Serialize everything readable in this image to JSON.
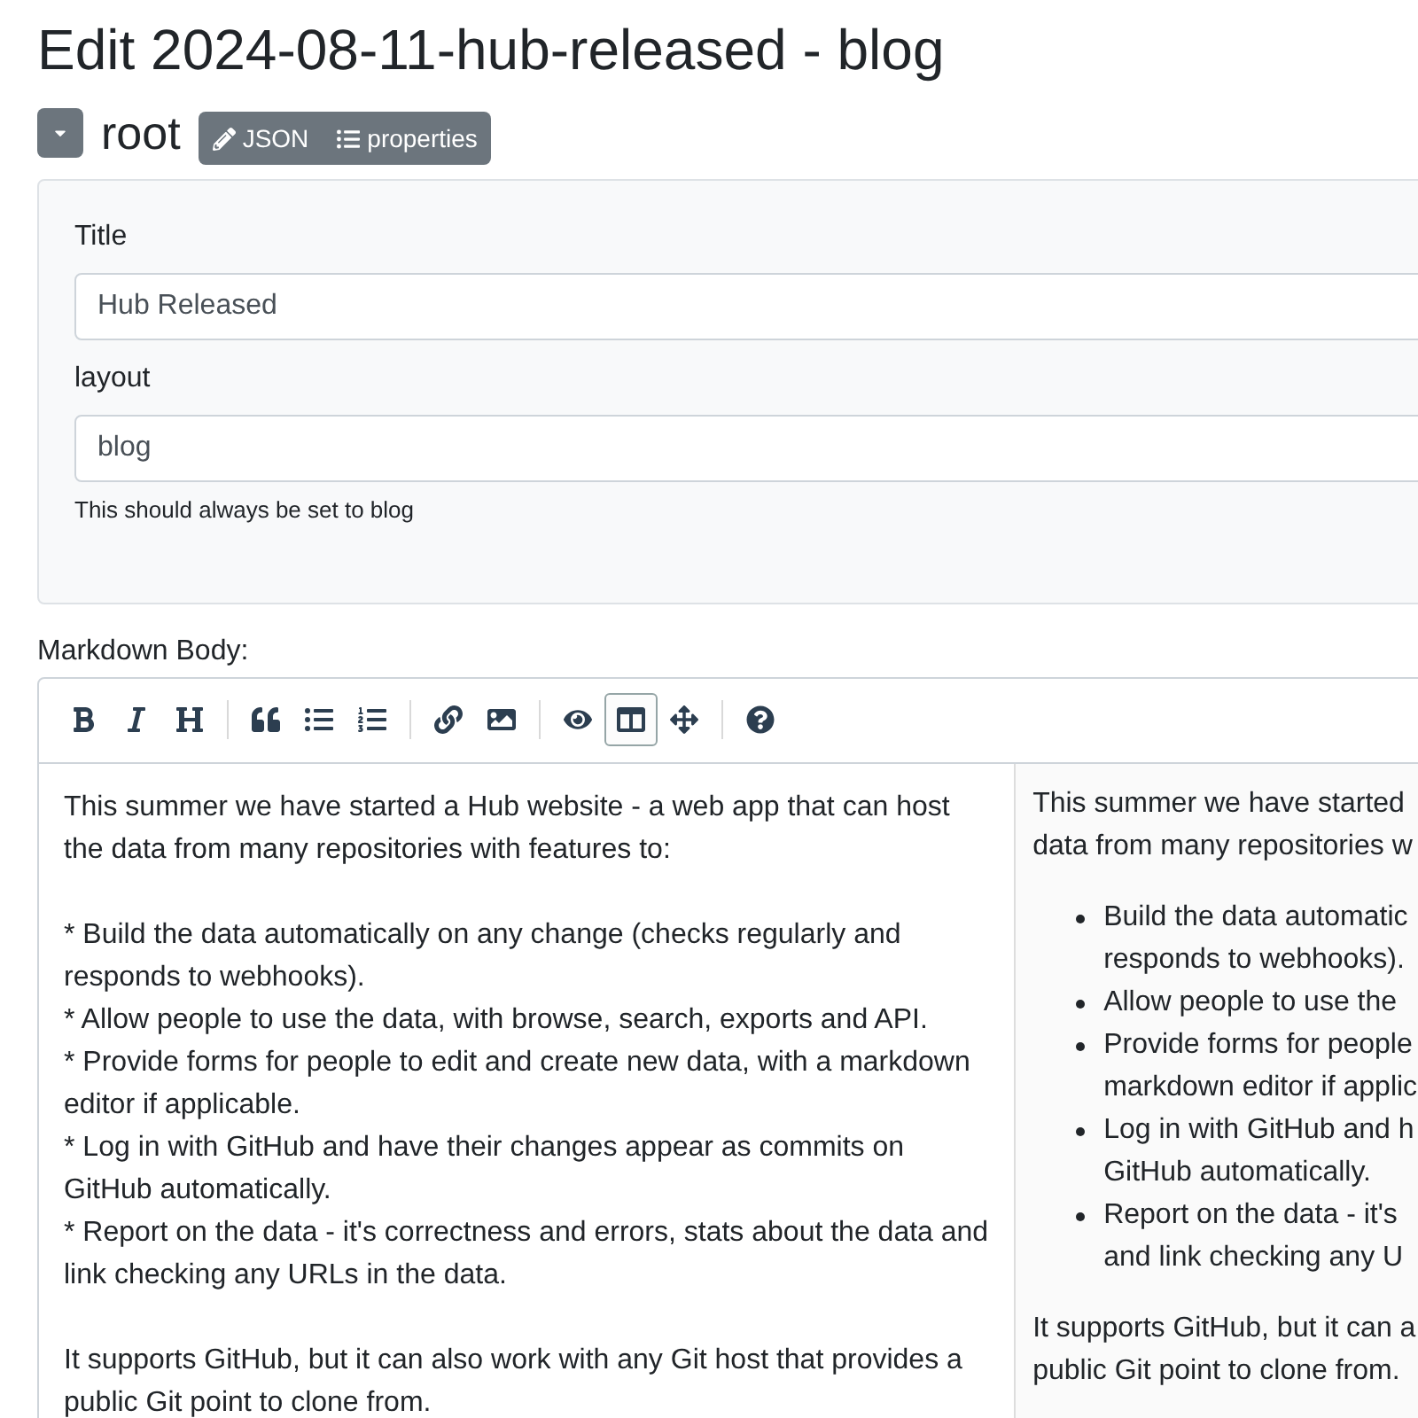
{
  "page_title": "Edit 2024-08-11-hub-released - blog",
  "root": {
    "label": "root",
    "buttons": [
      {
        "kind": "json",
        "label": "JSON"
      },
      {
        "kind": "properties",
        "label": "properties"
      }
    ]
  },
  "fields": [
    {
      "label": "Title",
      "value": "Hub Released"
    },
    {
      "label": "layout",
      "value": "blog",
      "help": "This should always be set to blog"
    }
  ],
  "markdown": {
    "label": "Markdown Body:",
    "toolbar": [
      [
        {
          "kind": "bold",
          "selected": false
        },
        {
          "kind": "italic",
          "selected": false
        },
        {
          "kind": "heading",
          "selected": false
        }
      ],
      [
        {
          "kind": "quote",
          "selected": false
        },
        {
          "kind": "unordered-list",
          "selected": false
        },
        {
          "kind": "ordered-list",
          "selected": false
        }
      ],
      [
        {
          "kind": "link",
          "selected": false
        },
        {
          "kind": "image",
          "selected": false
        }
      ],
      [
        {
          "kind": "preview",
          "selected": false
        },
        {
          "kind": "side-by-side",
          "selected": true
        },
        {
          "kind": "fullscreen",
          "selected": false
        }
      ],
      [
        {
          "kind": "help",
          "selected": false
        }
      ]
    ],
    "text": "This summer we have started a Hub website - a web app that can host\nthe data from many repositories with features to:\n\n* Build the data automatically on any change (checks regularly and\nresponds to webhooks).\n* Allow people to use the data, with browse, search, exports and API.\n* Provide forms for people to edit and create new data, with a markdown\neditor if applicable.\n* Log in with GitHub and have their changes appear as commits on\nGitHub automatically.\n* Report on the data - it's correctness and errors, stats about the data and\nlink checking any URLs in the data.\n\nIt supports GitHub, but it can also work with any Git host that provides a\npublic Git point to clone from.",
    "preview": [
      {
        "kind": "paragraph",
        "lines": [
          "This summer we have started",
          "data from many repositories w"
        ]
      },
      {
        "kind": "list",
        "items": [
          [
            "Build the data automatic",
            "responds to webhooks)."
          ],
          [
            "Allow people to use the"
          ],
          [
            "Provide forms for people",
            "markdown editor if applic"
          ],
          [
            "Log in with GitHub and h",
            "GitHub automatically."
          ],
          [
            "Report on the data - it's",
            "and link checking any U"
          ]
        ]
      },
      {
        "kind": "paragraph",
        "lines": [
          "It supports GitHub, but it can a",
          "public Git point to clone from."
        ]
      }
    ]
  }
}
